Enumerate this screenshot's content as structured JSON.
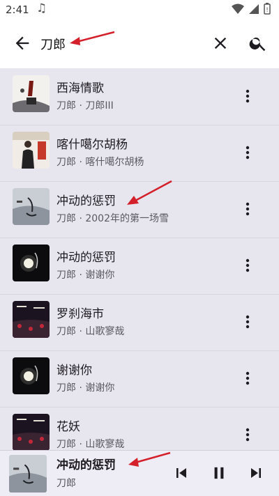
{
  "status": {
    "time": "2:41",
    "app_icon": "music-note-icon"
  },
  "search": {
    "query": "刀郎"
  },
  "songs": [
    {
      "title": "西海情歌",
      "subtitle": "刀郎 · 刀郎III"
    },
    {
      "title": "喀什噶尔胡杨",
      "subtitle": "刀郎 · 喀什噶尔胡杨"
    },
    {
      "title": "冲动的惩罚",
      "subtitle": "刀郎 · 2002年的第一场雪"
    },
    {
      "title": "冲动的惩罚",
      "subtitle": "刀郎 · 谢谢你"
    },
    {
      "title": "罗刹海市",
      "subtitle": "刀郎 · 山歌寥哉"
    },
    {
      "title": "谢谢你",
      "subtitle": "刀郎 · 谢谢你"
    },
    {
      "title": "花妖",
      "subtitle": "刀郎 · 山歌寥哉"
    }
  ],
  "player": {
    "title": "冲动的惩罚",
    "artist": "刀郎"
  },
  "colors": {
    "annotation_arrow": "#d3202a",
    "accent": "#1d1b20"
  }
}
